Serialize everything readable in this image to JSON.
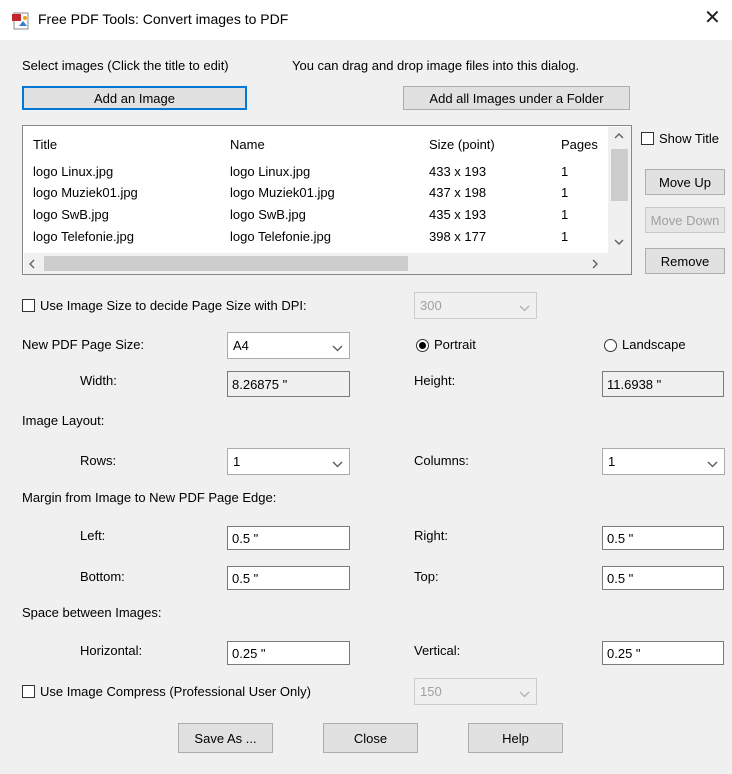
{
  "window": {
    "title": "Free PDF Tools: Convert images to PDF",
    "close_glyph": "✕"
  },
  "select_images_label": "Select images (Click the title to edit)",
  "drag_hint": "You can drag and drop image files into this dialog.",
  "add_image_button": "Add an Image",
  "add_folder_button": "Add all Images under a Folder",
  "list": {
    "columns": [
      "Title",
      "Name",
      "Size (point)",
      "Pages"
    ],
    "rows": [
      [
        "logo Linux.jpg",
        "logo Linux.jpg",
        "433 x 193",
        "1"
      ],
      [
        "logo Muziek01.jpg",
        "logo Muziek01.jpg",
        "437 x 198",
        "1"
      ],
      [
        "logo SwB.jpg",
        "logo SwB.jpg",
        "435 x 193",
        "1"
      ],
      [
        "logo Telefonie.jpg",
        "logo Telefonie.jpg",
        "398 x 177",
        "1"
      ]
    ]
  },
  "side": {
    "show_title": "Show Title",
    "move_up": "Move Up",
    "move_down": "Move Down",
    "remove": "Remove"
  },
  "dpi": {
    "label": "Use Image Size to decide Page Size with DPI:",
    "value": "300"
  },
  "page_size": {
    "label": "New PDF Page Size:",
    "value": "A4",
    "portrait": "Portrait",
    "landscape": "Landscape",
    "orientation_selected": "portrait"
  },
  "dimensions": {
    "width_label": "Width:",
    "width_value": "8.26875 \"",
    "height_label": "Height:",
    "height_value": "11.6938 \""
  },
  "layout": {
    "label": "Image Layout:",
    "rows_label": "Rows:",
    "rows_value": "1",
    "columns_label": "Columns:",
    "columns_value": "1"
  },
  "margin": {
    "label": "Margin from Image to New PDF Page Edge:",
    "left_label": "Left:",
    "left_value": "0.5 \"",
    "right_label": "Right:",
    "right_value": "0.5 \"",
    "bottom_label": "Bottom:",
    "bottom_value": "0.5 \"",
    "top_label": "Top:",
    "top_value": "0.5 \""
  },
  "spacing": {
    "label": "Space between Images:",
    "horizontal_label": "Horizontal:",
    "horizontal_value": "0.25 \"",
    "vertical_label": "Vertical:",
    "vertical_value": "0.25 \""
  },
  "compress": {
    "label": "Use Image Compress  (Professional User Only)",
    "value": "150"
  },
  "buttons": {
    "save_as": "Save As ...",
    "close": "Close",
    "help": "Help"
  },
  "colors": {
    "accent": "#0078d7",
    "dialog_bg": "#f0f0f0",
    "icon_red": "#c1272d"
  }
}
